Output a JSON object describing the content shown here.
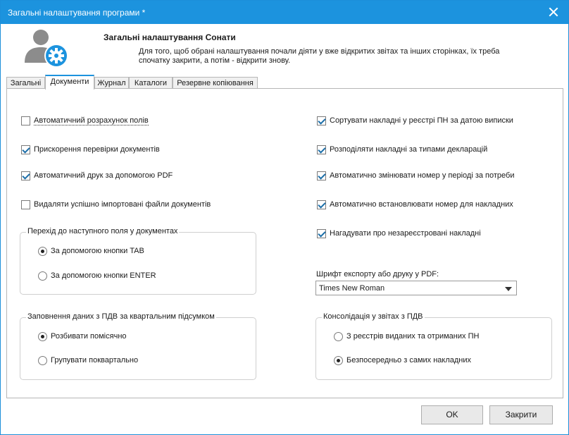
{
  "window": {
    "title": "Загальні налаштування програми *"
  },
  "header": {
    "title": "Загальні налаштування Сонати",
    "description": "Для того, щоб обрані налаштування почали діяти у вже відкритих звітах та інших сторінках, їх треба спочатку закрити, а потім - відкрити знову.",
    "icon": "user-settings-icon"
  },
  "tabs": [
    {
      "label": "Загальні",
      "active": false
    },
    {
      "label": "Документи",
      "active": true
    },
    {
      "label": "Журнал",
      "active": false
    },
    {
      "label": "Каталоги",
      "active": false
    },
    {
      "label": "Резервне копіювання",
      "active": false
    }
  ],
  "left_checks": [
    {
      "label": "Автоматичний розрахунок полів",
      "checked": false
    },
    {
      "label": "Прискорення перевірки документів",
      "checked": true
    },
    {
      "label": "Автоматичний друк за допомогою PDF",
      "checked": true
    },
    {
      "label": "Видаляти успішно імпортовані файли документів",
      "checked": false
    }
  ],
  "right_checks": [
    {
      "label": "Сортувати накладні у реєстрі ПН за датою виписки",
      "checked": true
    },
    {
      "label": "Розподіляти накладні за типами декларацій",
      "checked": true
    },
    {
      "label": "Автоматично змінювати номер у періоді за потреби",
      "checked": true
    },
    {
      "label": "Автоматично встановлювати номер для накладних",
      "checked": true
    },
    {
      "label": "Нагадувати про незареєстровані накладні",
      "checked": true
    }
  ],
  "group_next_field": {
    "legend": "Перехід до наступного поля у документах",
    "options": [
      {
        "label": "За допомогою кнопки TAB",
        "selected": true
      },
      {
        "label": "За допомогою кнопки ENTER",
        "selected": false
      }
    ]
  },
  "group_vat_fill": {
    "legend": "Заповнення даних з ПДВ за квартальним підсумком",
    "options": [
      {
        "label": "Розбивати помісячно",
        "selected": true
      },
      {
        "label": "Групувати поквартально",
        "selected": false
      }
    ]
  },
  "pdf_font": {
    "label": "Шрифт експорту або друку у PDF:",
    "value": "Times New Roman"
  },
  "group_consolidation": {
    "legend": "Консолідація у звітах з ПДВ",
    "options": [
      {
        "label": "З реєстрів виданих та отриманих ПН",
        "selected": false
      },
      {
        "label": "Безпосередньо з самих накладних",
        "selected": true
      }
    ]
  },
  "buttons": {
    "ok": "OK",
    "close": "Закрити"
  },
  "colors": {
    "accent": "#1c93de",
    "check": "#1c6ea8"
  }
}
